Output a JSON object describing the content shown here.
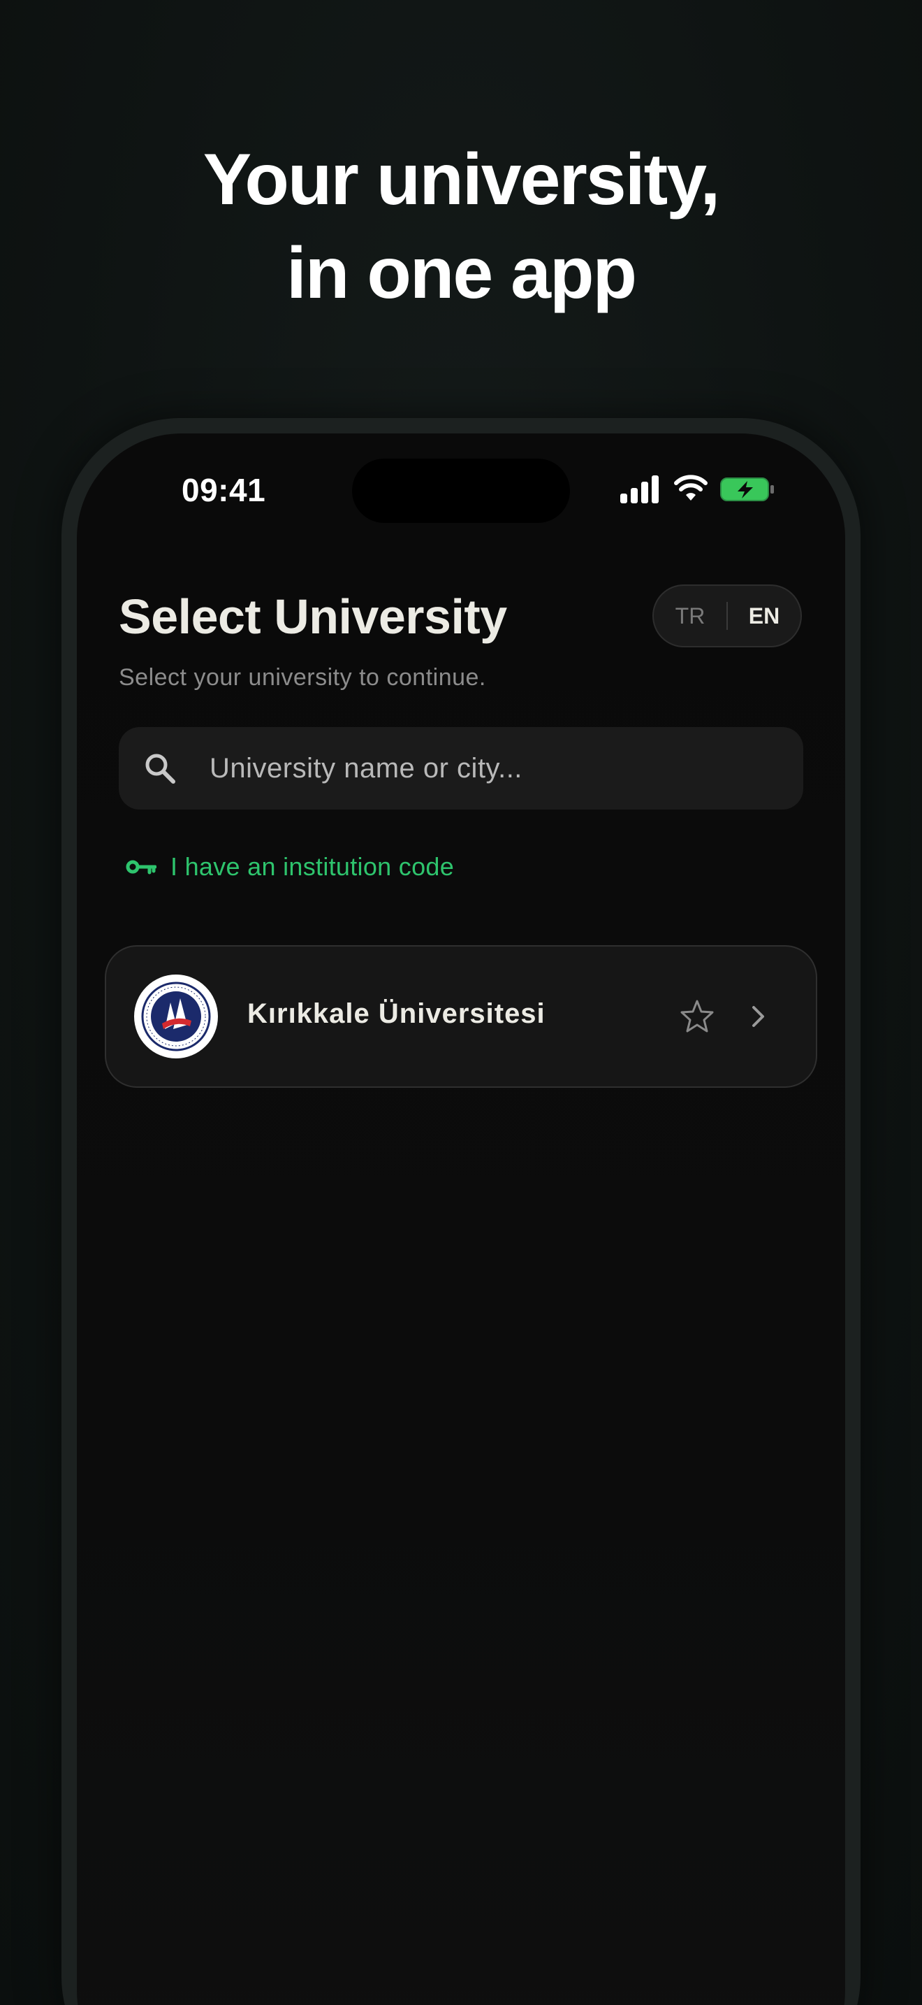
{
  "hero": {
    "line1": "Your university,",
    "line2": "in one app"
  },
  "status_bar": {
    "time": "09:41",
    "icons": [
      "signal-icon",
      "wifi-icon",
      "battery-charging-icon"
    ]
  },
  "screen": {
    "title": "Select University",
    "subtitle": "Select your university to continue.",
    "language": {
      "options": [
        "TR",
        "EN"
      ],
      "selected": "EN"
    },
    "search": {
      "placeholder": "University name or city...",
      "value": "",
      "icon": "search-icon"
    },
    "institution_code_link": {
      "label": "I have an institution code",
      "icon": "key-icon"
    },
    "universities": [
      {
        "name": "Kırıkkale Üniversitesi",
        "logo": "university-logo",
        "favorite": false
      }
    ]
  },
  "colors": {
    "background": "#0f1413",
    "screen": "#0a0a0a",
    "accent_green": "#2ec46d",
    "text_primary": "#ecebe4",
    "text_secondary": "#8c8c8c",
    "card": "#161616",
    "battery_green": "#39c75a"
  }
}
